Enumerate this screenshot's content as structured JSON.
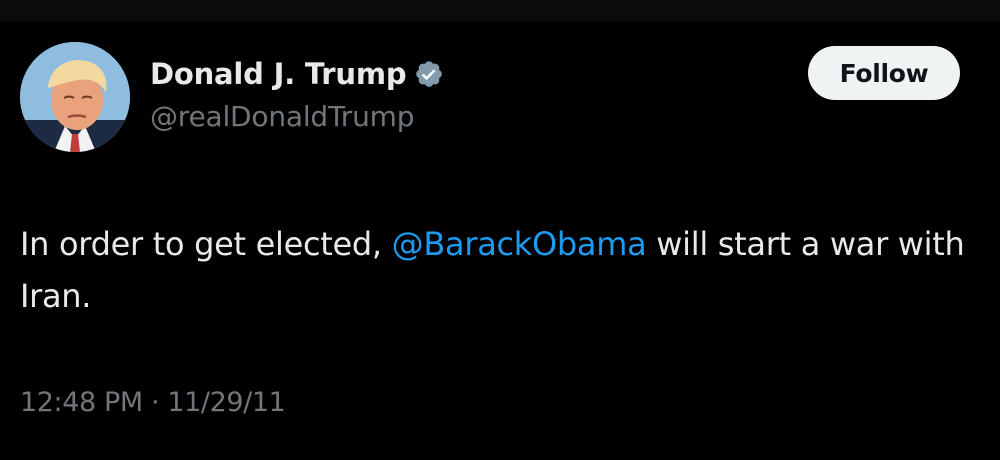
{
  "author": {
    "display_name": "Donald J. Trump",
    "handle": "@realDonaldTrump",
    "verified_icon": "verified-badge-icon",
    "verified_color": "#829aab"
  },
  "follow_button": {
    "label": "Follow"
  },
  "tweet": {
    "text_before": "In order to get elected, ",
    "mention": "@BarackObama",
    "text_after": " will start a war with Iran."
  },
  "meta": {
    "time": "12:48 PM",
    "separator": "·",
    "date": "11/29/11"
  },
  "colors": {
    "background": "#000000",
    "text_primary": "#e7e9ea",
    "text_secondary": "#71767b",
    "link": "#1d9bf0",
    "button_bg": "#eff3f4"
  }
}
